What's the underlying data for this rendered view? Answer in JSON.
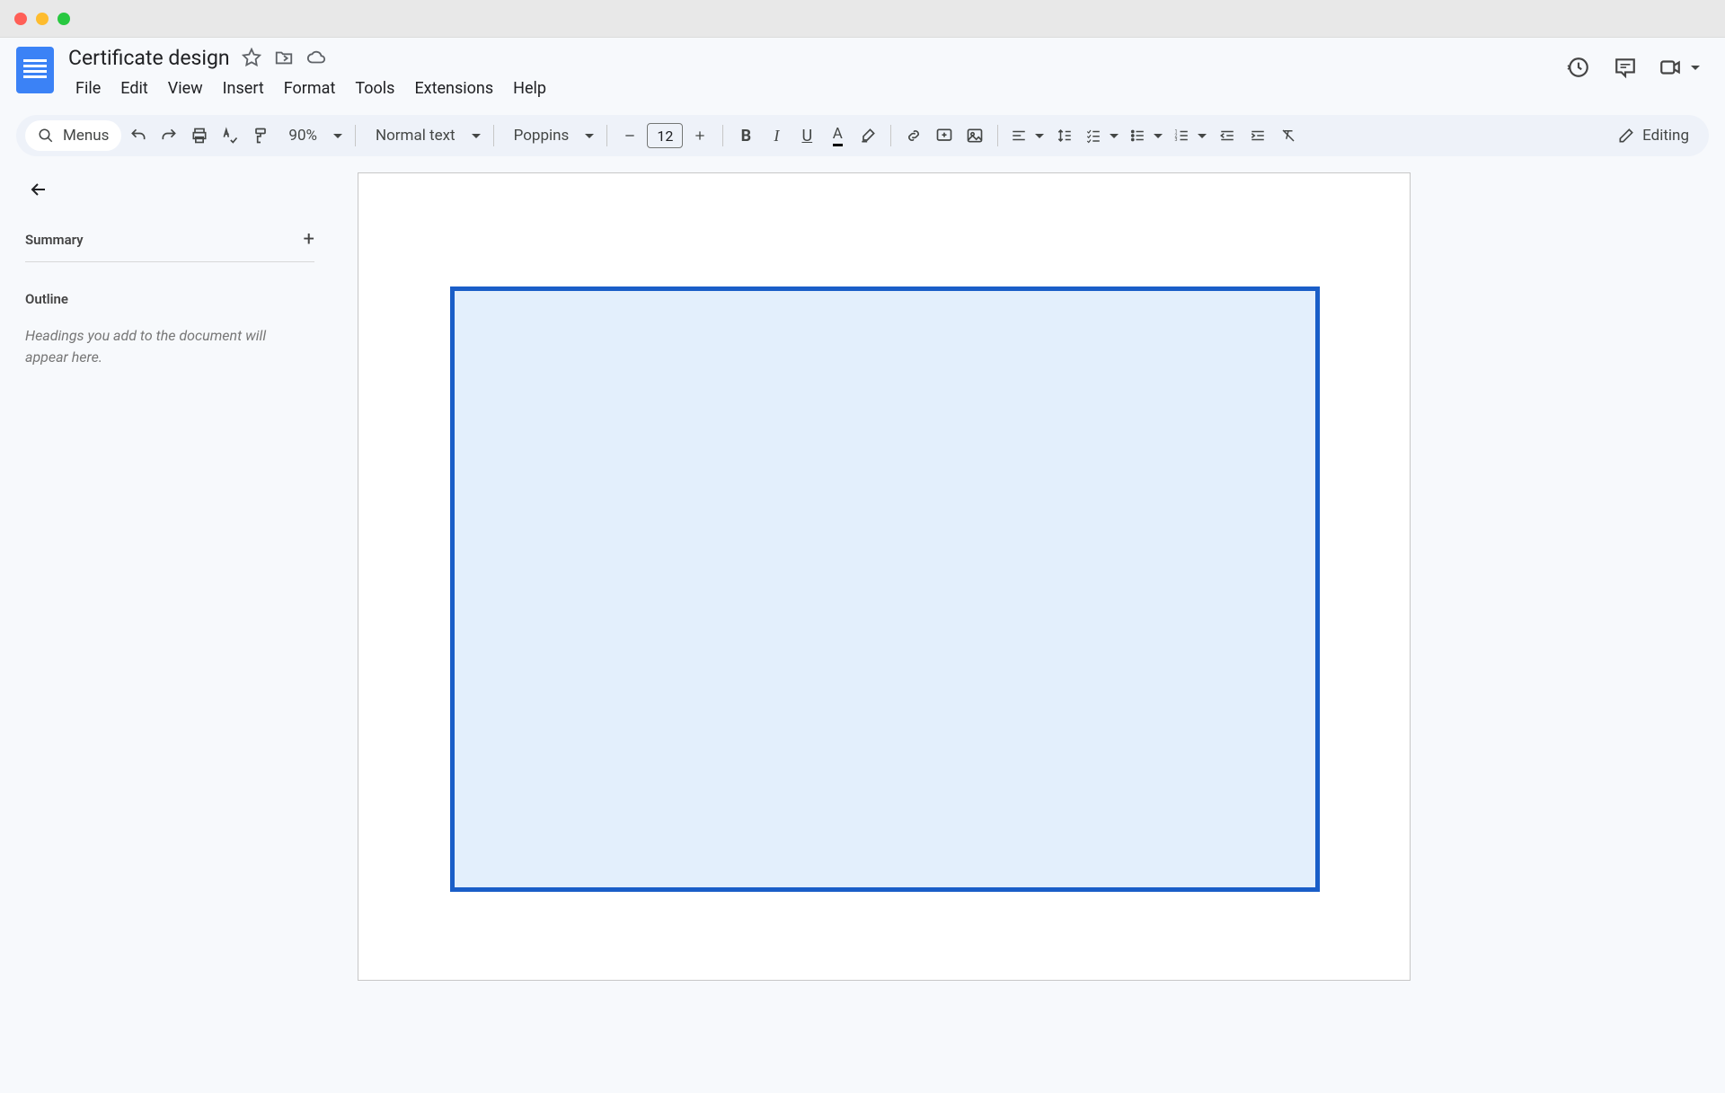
{
  "document": {
    "title": "Certificate design"
  },
  "menubar": [
    "File",
    "Edit",
    "View",
    "Insert",
    "Format",
    "Tools",
    "Extensions",
    "Help"
  ],
  "toolbar": {
    "menus_label": "Menus",
    "zoom": "90%",
    "style": "Normal text",
    "font": "Poppins",
    "font_size": "12",
    "editing_mode": "Editing"
  },
  "sidebar": {
    "summary_label": "Summary",
    "outline_label": "Outline",
    "outline_hint": "Headings you add to the document will appear here."
  },
  "colors": {
    "rect_border": "#1a5ec8",
    "rect_fill": "#e3effc"
  }
}
